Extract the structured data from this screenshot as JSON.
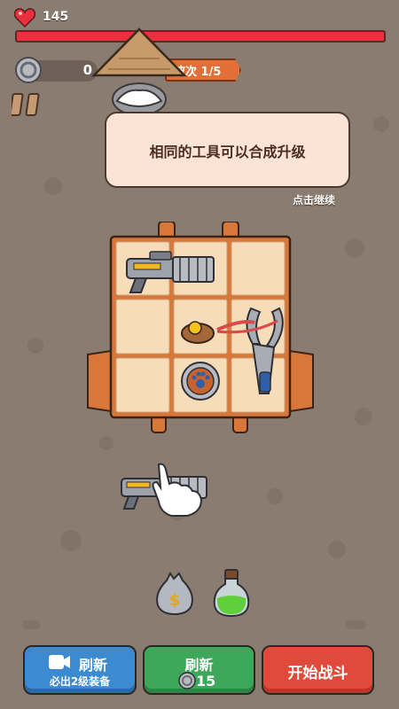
{
  "hud": {
    "hp": "145",
    "coins": "0",
    "wave": "波次 1/5"
  },
  "tutorial": {
    "message": "相同的工具可以合成升级",
    "continue_hint": "点击继续"
  },
  "board": {
    "rows": 3,
    "cols": 3,
    "items": [
      {
        "name": "minigun",
        "cells": "r1c1-r1c2"
      },
      {
        "name": "cookie-with-yellow-ball",
        "cells": "r2c2"
      },
      {
        "name": "slingshot",
        "cells": "r2c3-r3c3"
      },
      {
        "name": "paw-shield",
        "cells": "r3c2"
      }
    ]
  },
  "dragging_item": "minigun",
  "shop_items": [
    "money-bag",
    "green-potion"
  ],
  "buttons": {
    "refresh_ad": {
      "label": "刷新",
      "sub": "必出2级装备"
    },
    "refresh_coin": {
      "label": "刷新",
      "cost": "15"
    },
    "start_battle": {
      "label": "开始战斗"
    }
  },
  "colors": {
    "background": "#8a7c70",
    "hp_bar": "#e8313c",
    "board_wood": "#d8773a",
    "cell": "#f6dcb8",
    "btn_blue": "#3c8ad0",
    "btn_green": "#3ea85a",
    "btn_red": "#e14a3a"
  }
}
